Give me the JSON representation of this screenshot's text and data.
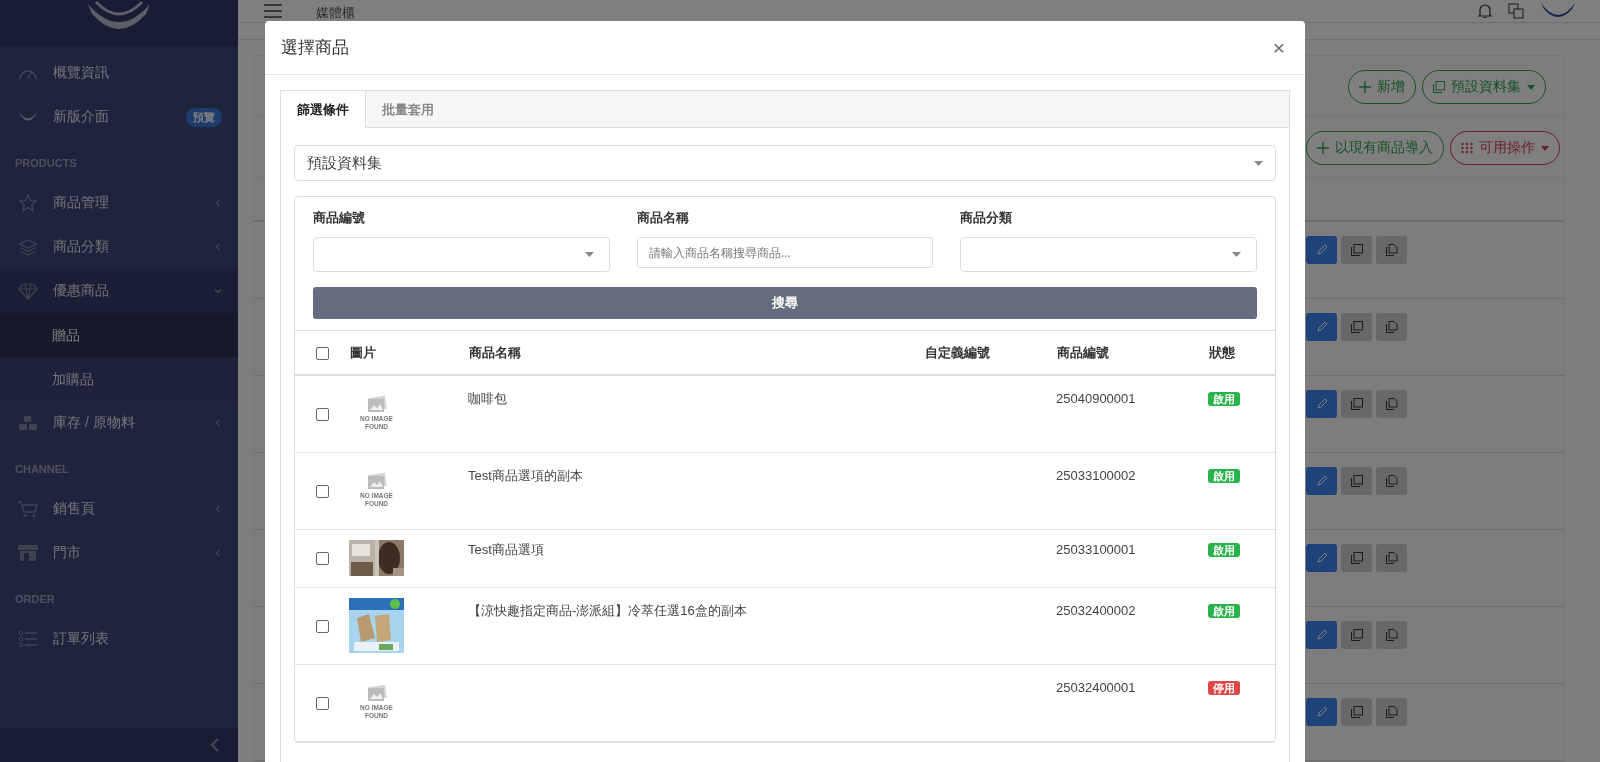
{
  "sidebar": {
    "sections": [
      {
        "items": [
          {
            "label": "概覽資訊",
            "has_submenu": false
          },
          {
            "label": "新版介面",
            "has_submenu": false,
            "badge": "預覽"
          }
        ]
      },
      {
        "heading": "PRODUCTS",
        "items": [
          {
            "label": "商品管理",
            "has_submenu": true,
            "expanded": false
          },
          {
            "label": "商品分類",
            "has_submenu": true,
            "expanded": false
          },
          {
            "label": "優惠商品",
            "has_submenu": true,
            "expanded": true,
            "children": [
              {
                "label": "贈品",
                "selected": true
              },
              {
                "label": "加購品",
                "selected": false
              }
            ]
          },
          {
            "label": "庫存 / 原物料",
            "has_submenu": true,
            "expanded": false
          }
        ]
      },
      {
        "heading": "CHANNEL",
        "items": [
          {
            "label": "銷售頁",
            "has_submenu": true,
            "expanded": false
          },
          {
            "label": "門市",
            "has_submenu": true,
            "expanded": false
          }
        ]
      },
      {
        "heading": "ORDER",
        "items": [
          {
            "label": "訂單列表",
            "has_submenu": false
          }
        ]
      }
    ]
  },
  "topbar": {
    "title": "媒體櫃"
  },
  "background_page": {
    "toolbar_buttons": [
      {
        "label": "新增",
        "kind": "plus",
        "caret": false
      },
      {
        "label": "預設資料集",
        "kind": "copy",
        "caret": true
      }
    ],
    "toolbar_buttons_2": [
      {
        "label": "以現有商品導入",
        "kind": "plus",
        "caret": false
      },
      {
        "label": "可用操作",
        "kind": "grid",
        "caret": true
      }
    ]
  },
  "modal": {
    "title": "選擇商品",
    "close": "×",
    "tabs": [
      {
        "label": "篩選條件",
        "selected": true
      },
      {
        "label": "批量套用",
        "selected": false
      }
    ],
    "dataset_select": {
      "value": "預設資料集"
    },
    "filters": [
      {
        "label": "商品編號",
        "kind": "select"
      },
      {
        "label": "商品名稱",
        "kind": "input",
        "placeholder": "請輸入商品名稱搜尋商品..."
      },
      {
        "label": "商品分類",
        "kind": "select"
      }
    ],
    "search_button": "搜尋",
    "table": {
      "select_all": {
        "checked": false
      },
      "columns": [
        "圖片",
        "商品名稱",
        "自定義編號",
        "商品編號",
        "狀態"
      ],
      "rows": [
        {
          "checked": false,
          "image": {
            "kind": "none",
            "text": "NO IMAGE FOUND"
          },
          "name": "咖啡包",
          "product_no": "25040900001",
          "status": {
            "label": "啟用",
            "color": "#28b44a"
          }
        },
        {
          "checked": false,
          "image": {
            "kind": "none",
            "text": "NO IMAGE FOUND"
          },
          "name": "Test商品選項的副本",
          "product_no": "25033100002",
          "status": {
            "label": "啟用",
            "color": "#28b44a"
          }
        },
        {
          "checked": false,
          "image": {
            "kind": "salon"
          },
          "name": "Test商品選項",
          "product_no": "25033100001",
          "status": {
            "label": "啟用",
            "color": "#28b44a"
          }
        },
        {
          "checked": false,
          "image": {
            "kind": "product"
          },
          "name": "【涼快趣指定商品-澎派組】冷萃任選16盒的副本",
          "product_no": "25032400002",
          "status": {
            "label": "啟用",
            "color": "#28b44a"
          }
        },
        {
          "checked": false,
          "image": {
            "kind": "none",
            "text": "NO IMAGE FOUND"
          },
          "product_no": "25032400001",
          "status": {
            "label": "停用",
            "color": "#e04848"
          }
        }
      ]
    }
  }
}
